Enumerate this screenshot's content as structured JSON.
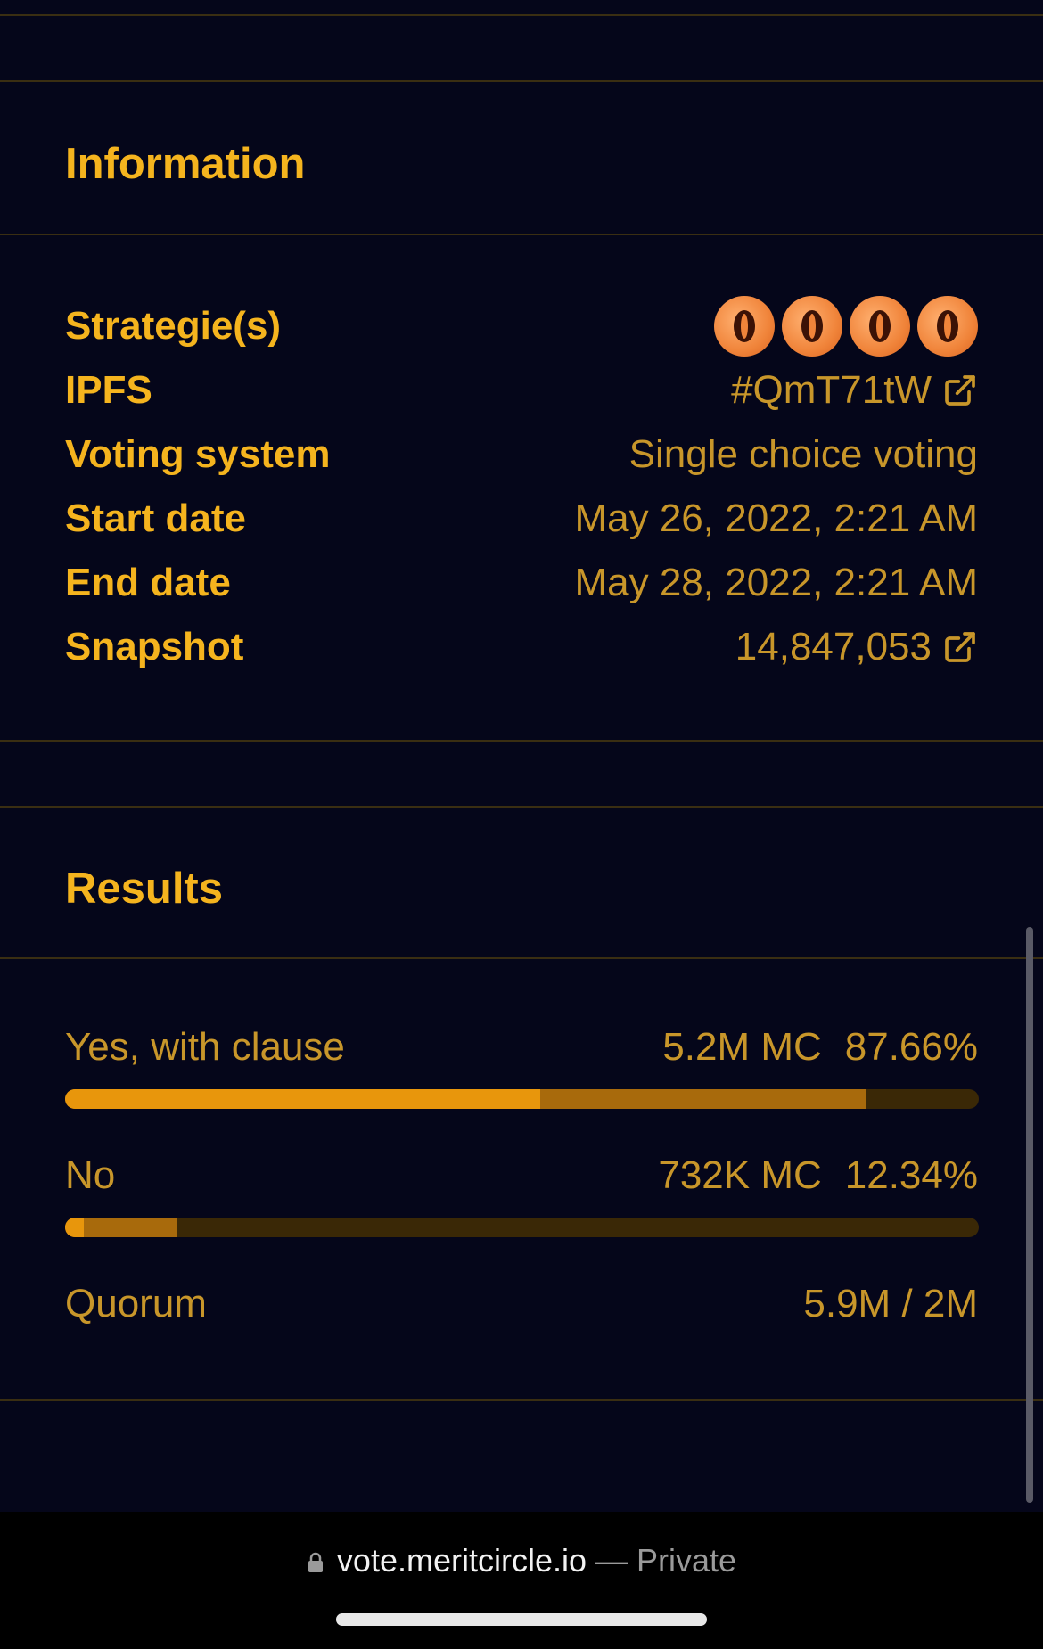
{
  "information": {
    "title": "Information",
    "rows": [
      {
        "label": "Strategie(s)",
        "value": ""
      },
      {
        "label": "IPFS",
        "value": "#QmT71tW"
      },
      {
        "label": "Voting system",
        "value": "Single choice voting"
      },
      {
        "label": "Start date",
        "value": "May 26, 2022, 2:21 AM"
      },
      {
        "label": "End date",
        "value": "May 28, 2022, 2:21 AM"
      },
      {
        "label": "Snapshot",
        "value": "14,847,053"
      }
    ],
    "strategy_icon": "meritcircle-logo-icon"
  },
  "results": {
    "title": "Results",
    "choices": [
      {
        "label": "Yes, with clause",
        "amount": "5.2M MC",
        "percent": "87.66%",
        "bar_primary_fraction": 0.52,
        "bar_secondary_fraction": 0.877
      },
      {
        "label": "No",
        "amount": "732K MC",
        "percent": "12.34%",
        "bar_primary_fraction": 0.02,
        "bar_secondary_fraction": 0.123
      }
    ],
    "quorum": {
      "label": "Quorum",
      "value": "5.9M / 2M"
    }
  },
  "browser": {
    "url": "vote.meritcircle.io",
    "separator": " — ",
    "mode": "Private"
  },
  "colors": {
    "background": "#05061a",
    "accent": "#f5b41e",
    "value_text": "#c8962a",
    "bar_primary": "#e8960c",
    "bar_secondary": "#a86a0c",
    "bar_track": "#3a2806"
  }
}
